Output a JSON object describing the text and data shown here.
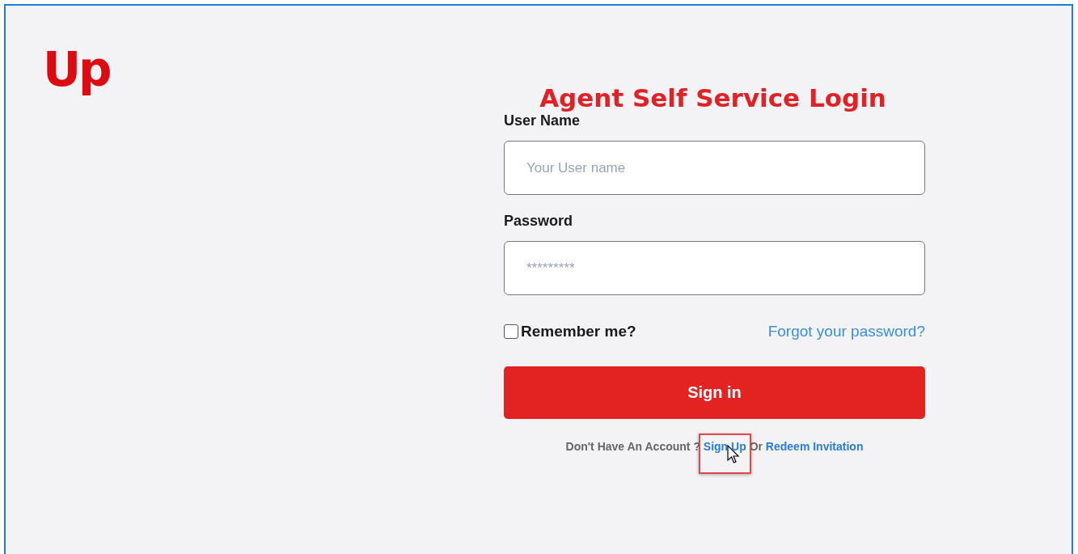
{
  "logo": {
    "text": "Up"
  },
  "title": "Agent Self Service Login",
  "fields": [
    {
      "label": "User Name",
      "placeholder": "Your User name"
    },
    {
      "label": "Password",
      "placeholder": "*********"
    }
  ],
  "remember": {
    "label": "Remember me?",
    "checked": false
  },
  "forgot_link": "Forgot your password?",
  "sign_in_button": "Sign in",
  "footer": {
    "prompt": "Don't Have An Account ?",
    "sign_up": {
      "text": "Sign Up",
      "highlighted": true
    },
    "separator": "Or",
    "redeem": "Redeem Invitation"
  }
}
